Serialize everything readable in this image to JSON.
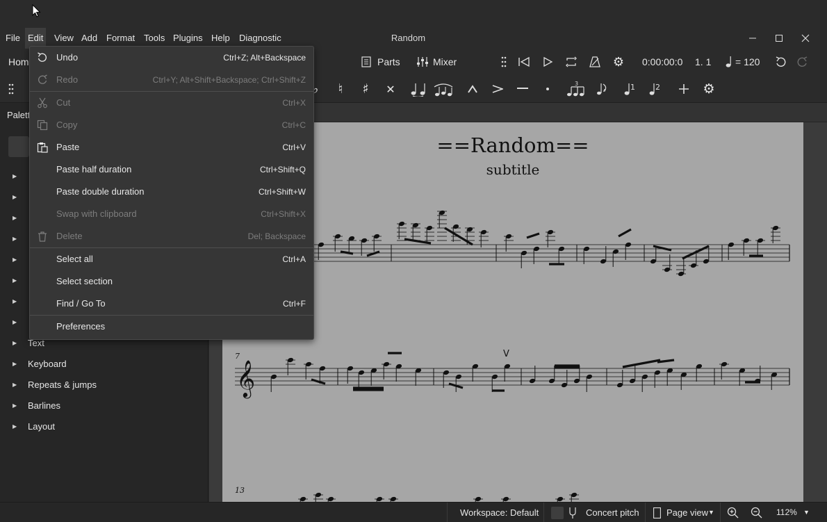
{
  "menubar": {
    "items": [
      "File",
      "Edit",
      "View",
      "Add",
      "Format",
      "Tools",
      "Plugins",
      "Help",
      "Diagnostic"
    ],
    "window_title": "Random"
  },
  "toolbar": {
    "home_tab": "Hom",
    "parts": "Parts",
    "mixer": "Mixer",
    "time": "0:00:00:0",
    "position": "1. 1",
    "tempo": "= 120"
  },
  "palettes": {
    "title": "Palett",
    "items": [
      "Text",
      "Keyboard",
      "Repeats & jumps",
      "Barlines",
      "Layout"
    ]
  },
  "score": {
    "title": "==Random==",
    "subtitle": "subtitle",
    "measure_numbers": [
      "7",
      "13"
    ],
    "articulation": "V"
  },
  "edit_menu": {
    "items": [
      {
        "label": "Undo",
        "shortcut": "Ctrl+Z; Alt+Backspace",
        "enabled": true,
        "icon": "undo-icon"
      },
      {
        "label": "Redo",
        "shortcut": "Ctrl+Y; Alt+Shift+Backspace; Ctrl+Shift+Z",
        "enabled": false,
        "icon": "redo-icon"
      },
      {
        "label": "Cut",
        "shortcut": "Ctrl+X",
        "enabled": false,
        "icon": "scissors-icon"
      },
      {
        "label": "Copy",
        "shortcut": "Ctrl+C",
        "enabled": false,
        "icon": "copy-icon"
      },
      {
        "label": "Paste",
        "shortcut": "Ctrl+V",
        "enabled": true,
        "icon": "clipboard-icon"
      },
      {
        "label": "Paste half duration",
        "shortcut": "Ctrl+Shift+Q",
        "enabled": true
      },
      {
        "label": "Paste double duration",
        "shortcut": "Ctrl+Shift+W",
        "enabled": true
      },
      {
        "label": "Swap with clipboard",
        "shortcut": "Ctrl+Shift+X",
        "enabled": false
      },
      {
        "label": "Delete",
        "shortcut": "Del; Backspace",
        "enabled": false,
        "icon": "trash-icon"
      },
      {
        "label": "Select all",
        "shortcut": "Ctrl+A",
        "enabled": true
      },
      {
        "label": "Select section",
        "shortcut": "",
        "enabled": true
      },
      {
        "label": "Find / Go To",
        "shortcut": "Ctrl+F",
        "enabled": true
      },
      {
        "label": "Preferences",
        "shortcut": "",
        "enabled": true
      }
    ]
  },
  "statusbar": {
    "workspace": "Workspace: Default",
    "concert_pitch": "Concert pitch",
    "view_mode": "Page view",
    "zoom": "112%"
  },
  "colors": {
    "background": "#2b2b2b",
    "menu_bg": "#363636",
    "page": "#a6a6a6",
    "disabled_text": "#7d7d7d"
  }
}
